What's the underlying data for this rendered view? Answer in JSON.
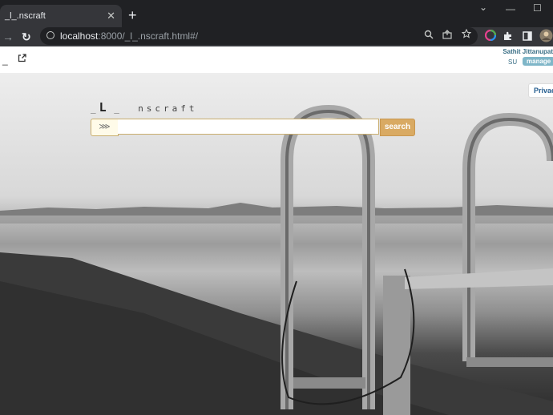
{
  "browser": {
    "tab": {
      "title": "_l_.nscraft",
      "close": "✕"
    },
    "new_tab": "+",
    "window_controls": {
      "minimize": "—",
      "maximize": "☐",
      "chevron": "⌄"
    },
    "address_bar": {
      "host": "localhost",
      "path": ":8000/_l_.nscraft.html#/"
    },
    "nav": {
      "back": "←",
      "forward": "→",
      "reload": "↻"
    }
  },
  "page": {
    "header": {
      "left_glyph": "_",
      "external_link_icon": "↗",
      "user_name": "Sathit Jittanupat",
      "user_initials": "SU",
      "manage_label": "manage"
    },
    "privacy_label": "Privac",
    "logo": {
      "part1": "_",
      "part2": "L",
      "part3": "_",
      "part4": "nscraft"
    },
    "search": {
      "prefix_label": "⋙",
      "value": "",
      "placeholder": "",
      "button_label": "search"
    }
  },
  "colors": {
    "search_button": "#d9aa63",
    "search_border": "#c9ad6e",
    "manage_badge": "#7fb6c8",
    "user_text": "#3a6f86"
  },
  "icons": [
    "info-icon",
    "zoom-icon",
    "share-icon",
    "star-icon",
    "color-extension-icon",
    "puzzle-extensions-icon",
    "sidebar-icon",
    "profile-avatar-icon",
    "external-link-icon"
  ]
}
